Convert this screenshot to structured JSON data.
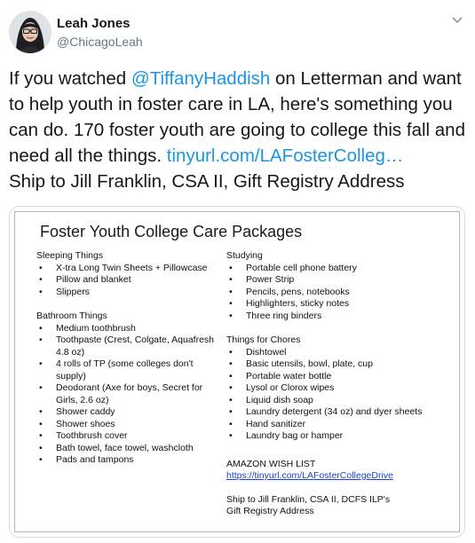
{
  "author": {
    "name": "Leah Jones",
    "handle": "@ChicagoLeah"
  },
  "menu_icon": "chevron-down-icon",
  "tweet": {
    "text_1": "If you watched ",
    "mention": "@TiffanyHaddish",
    "text_2": " on Letterman and want to help youth in foster care in LA, here's something you can do. 170 foster youth are going to college this fall and need all the things. ",
    "link": "tinyurl.com/LAFosterColleg…",
    "line_2": "Ship to Jill Franklin, CSA II, Gift Registry Address"
  },
  "flyer": {
    "title": "Foster Youth College Care Packages",
    "left": {
      "sleeping": {
        "heading": "Sleeping Things",
        "items": [
          "X-tra Long Twin Sheets + Pillowcase",
          "Pillow and blanket",
          "Slippers"
        ]
      },
      "bathroom": {
        "heading": "Bathroom Things",
        "items": [
          "Medium toothbrush",
          "Toothpaste (Crest, Colgate, Aquafresh 4.8 oz)",
          "4 rolls of TP (some colleges don't supply)",
          "Deodorant (Axe for boys, Secret for Girls, 2.6 oz)",
          "Shower caddy",
          "Shower shoes",
          "Toothbrush cover",
          "Bath towel, face towel, washcloth",
          "Pads and tampons"
        ]
      }
    },
    "right": {
      "studying": {
        "heading": "Studying",
        "items": [
          "Portable cell phone battery",
          "Power Strip",
          "Pencils, pens, notebooks",
          "Highlighters, sticky notes",
          "Three ring binders"
        ]
      },
      "chores": {
        "heading": "Things for Chores",
        "items": [
          "Dishtowel",
          "Basic utensils, bowl, plate, cup",
          "Portable water bottle",
          "Lysol or Clorox wipes",
          "Liquid dish soap",
          "Laundry detergent (34 oz) and dyer sheets",
          "Hand sanitizer",
          "Laundry bag or hamper"
        ]
      },
      "amazon_heading": "AMAZON WISH LIST",
      "amazon_link": "https://tinyurl.com/LAFosterCollegeDrive",
      "ship_line_1": "Ship to Jill Franklin, CSA II, DCFS ILP's",
      "ship_line_2": "Gift Registry Address"
    }
  }
}
